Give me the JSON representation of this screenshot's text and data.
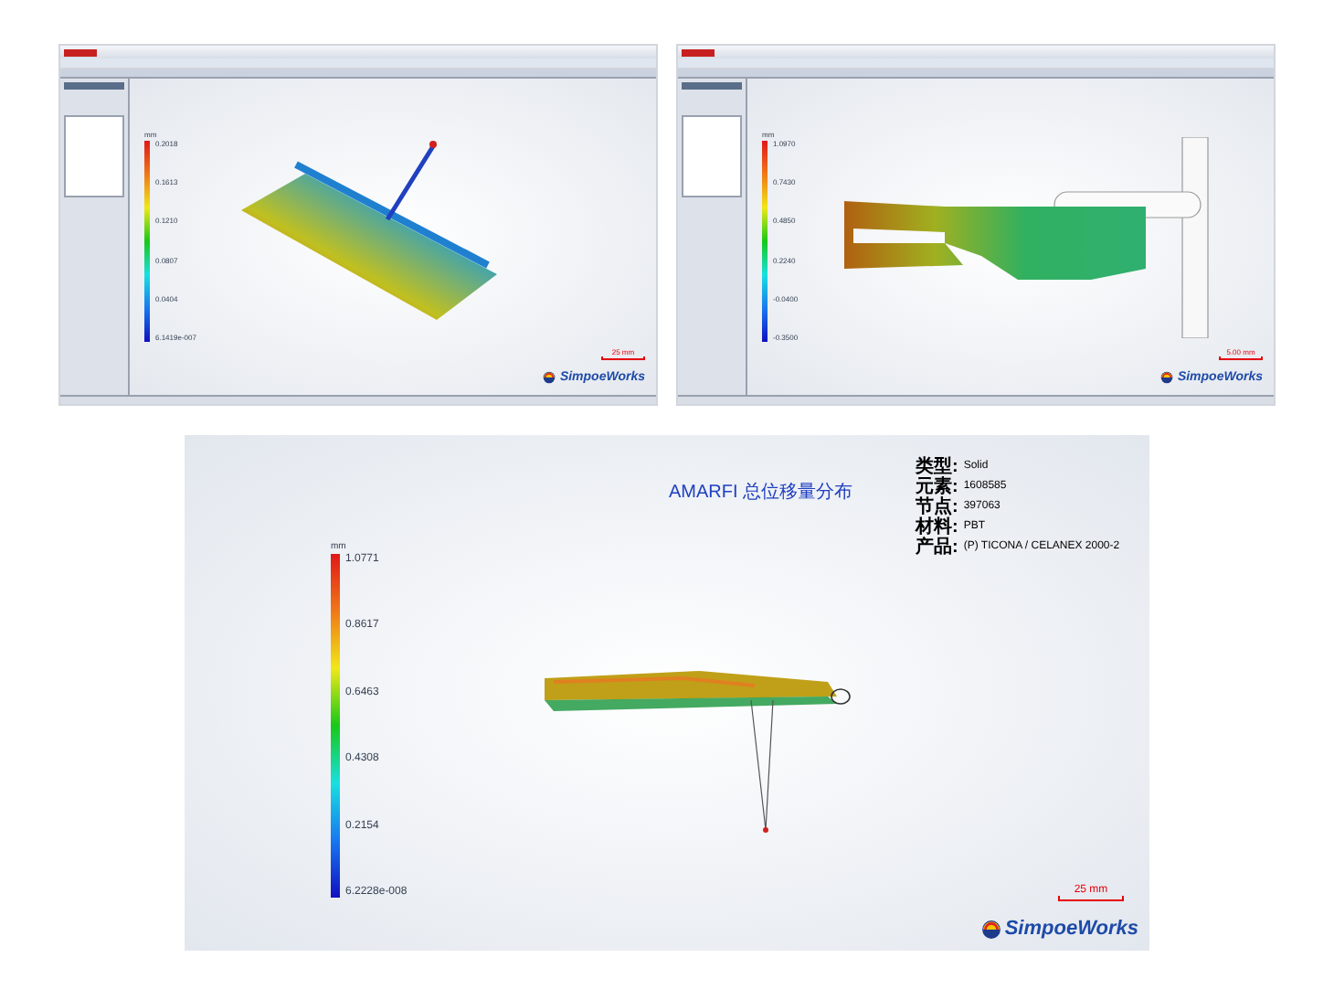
{
  "screens": [
    {
      "kind": "plate",
      "legend": {
        "unit": "mm",
        "ticks": [
          "0.2018",
          "0.1613",
          "0.1210",
          "0.0807",
          "0.0404",
          "6.1419e-007"
        ]
      },
      "scale": "25 mm",
      "logo": "SimpoeWorks"
    },
    {
      "kind": "fork",
      "legend": {
        "unit": "mm",
        "ticks": [
          "1.0970",
          "0.7430",
          "0.4850",
          "0.2240",
          "-0.0400",
          "-0.3500"
        ]
      },
      "scale": "5.00 mm",
      "logo": "SimpoeWorks"
    }
  ],
  "result": {
    "title": "AMARFI 总位移量分布",
    "info": [
      {
        "label": "类型:",
        "value": "Solid"
      },
      {
        "label": "元素:",
        "value": "1608585"
      },
      {
        "label": "节点:",
        "value": "397063"
      },
      {
        "label": "材料:",
        "value": "PBT"
      },
      {
        "label": "产品:",
        "value": "(P) TICONA / CELANEX 2000-2"
      }
    ],
    "legend": {
      "unit": "mm",
      "ticks": [
        "1.0771",
        "0.8617",
        "0.6463",
        "0.4308",
        "0.2154",
        "6.2228e-008"
      ]
    },
    "scale": "25 mm",
    "logo": "SimpoeWorks"
  }
}
